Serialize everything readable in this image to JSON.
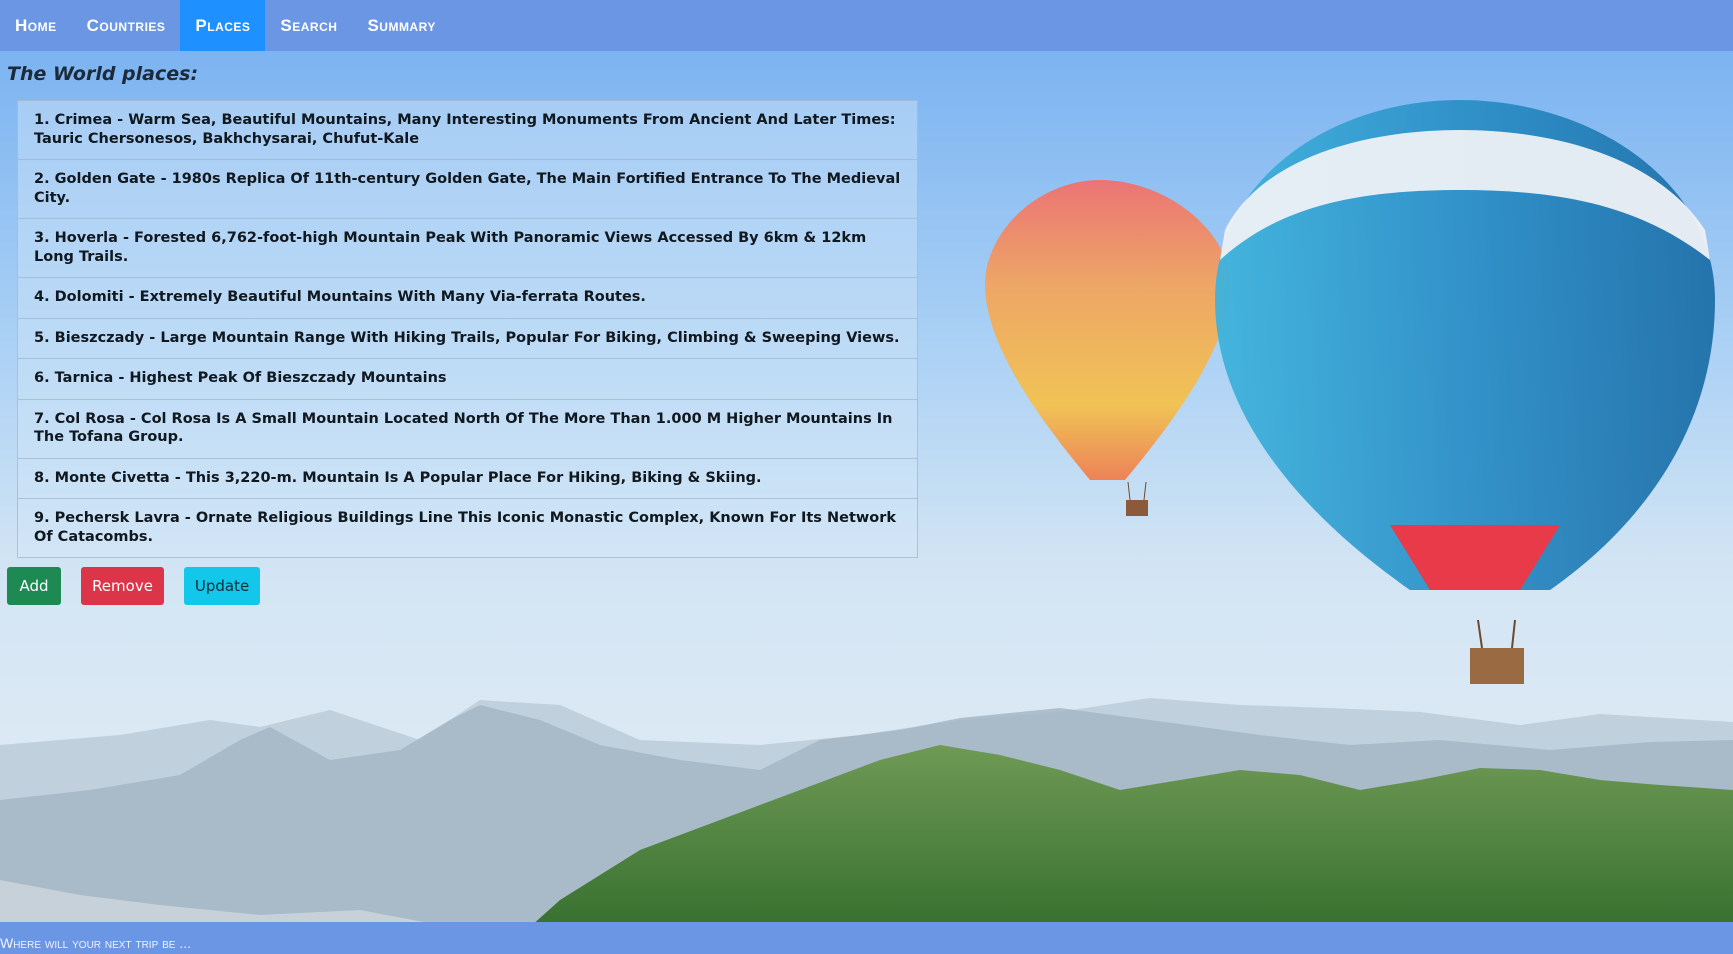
{
  "nav": {
    "items": [
      {
        "label": "Home"
      },
      {
        "label": "Countries"
      },
      {
        "label": "Places"
      },
      {
        "label": "Search"
      },
      {
        "label": "Summary"
      }
    ],
    "active_index": 2
  },
  "main": {
    "title": "The World places:",
    "places": [
      "1. Crimea - Warm Sea, Beautiful Mountains, Many Interesting Monuments From Ancient And Later Times: Tauric Chersonesos, Bakhchysarai, Chufut-Kale",
      "2. Golden Gate - 1980s Replica Of 11th-century Golden Gate, The Main Fortified Entrance To The Medieval City.",
      "3. Hoverla - Forested 6,762-foot-high Mountain Peak With Panoramic Views Accessed By 6km & 12km Long Trails.",
      "4. Dolomiti - Extremely Beautiful Mountains With Many Via-ferrata Routes.",
      "5. Bieszczady - Large Mountain Range With Hiking Trails, Popular For Biking, Climbing & Sweeping Views.",
      "6. Tarnica - Highest Peak Of Bieszczady Mountains",
      "7. Col Rosa - Col Rosa Is A Small Mountain Located North Of The More Than 1.000 M Higher Mountains In The Tofana Group.",
      "8. Monte Civetta - This 3,220-m. Mountain Is A Popular Place For Hiking, Biking & Skiing.",
      "9. Pechersk Lavra - Ornate Religious Buildings Line This Iconic Monastic Complex, Known For Its Network Of Catacombs."
    ],
    "buttons": {
      "add": "Add",
      "remove": "Remove",
      "update": "Update"
    }
  },
  "footer": {
    "text": "Where will your next trip be ..."
  },
  "colors": {
    "nav_bg": "#6b96e4",
    "nav_active": "#1e90ff",
    "add": "#1c8a52",
    "remove": "#dc3549",
    "update": "#13c7ea"
  },
  "background": {
    "image": "hot-air-balloons-over-mountains"
  }
}
